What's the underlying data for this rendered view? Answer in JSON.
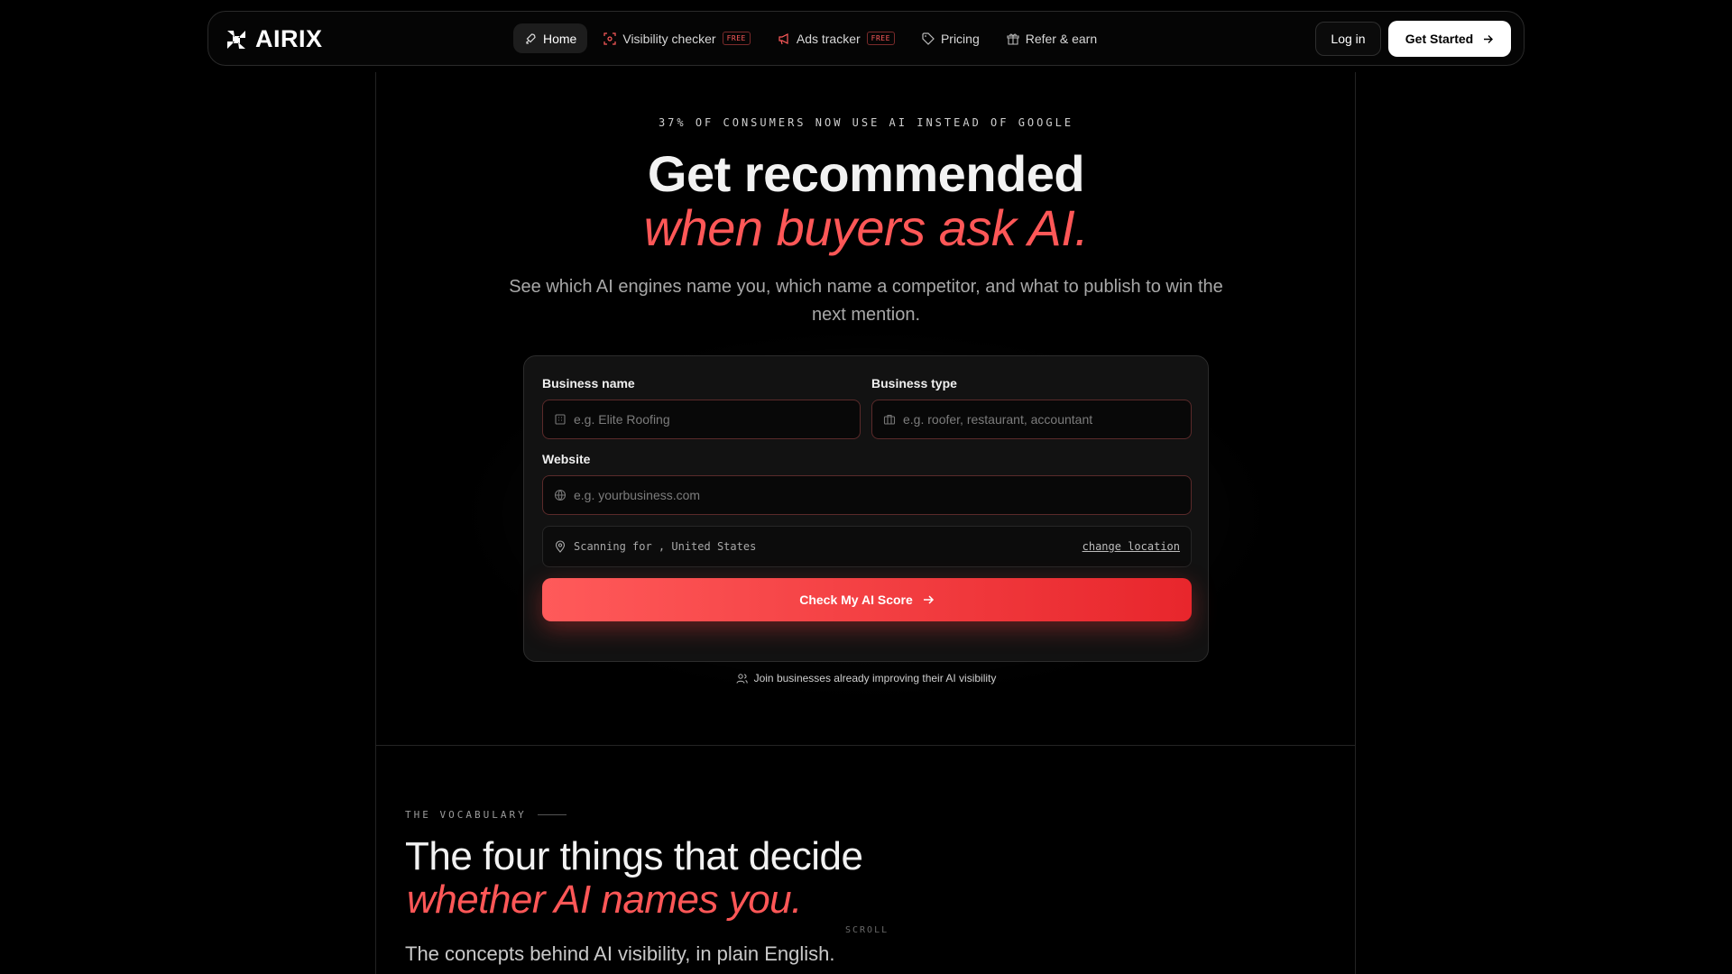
{
  "nav": {
    "logo": "AIRIX",
    "items": [
      {
        "label": "Home",
        "icon": "rocket-icon",
        "active": true
      },
      {
        "label": "Visibility checker",
        "icon": "scan-icon",
        "badge": "FREE"
      },
      {
        "label": "Ads tracker",
        "icon": "megaphone-icon",
        "badge": "FREE"
      },
      {
        "label": "Pricing",
        "icon": "tag-icon"
      },
      {
        "label": "Refer & earn",
        "icon": "gift-icon"
      }
    ],
    "login": "Log in",
    "get_started": "Get Started"
  },
  "hero": {
    "eyebrow": "37% OF CONSUMERS NOW USE AI INSTEAD OF GOOGLE",
    "title": "Get recommended",
    "title_accent": "when buyers ask AI.",
    "subtitle": "See which AI engines name you, which name a competitor, and what to publish to win the next mention."
  },
  "form": {
    "business_name_label": "Business name",
    "business_name_placeholder": "e.g. Elite Roofing",
    "business_type_label": "Business type",
    "business_type_placeholder": "e.g. roofer, restaurant, accountant",
    "website_label": "Website",
    "website_placeholder": "e.g. yourbusiness.com",
    "scan_text": "Scanning for , United States",
    "change_location": "change location",
    "cta": "Check My AI Score",
    "join_text": "Join businesses already improving their AI visibility"
  },
  "vocabulary": {
    "eyebrow": "THE VOCABULARY",
    "title": "The four things that decide",
    "title_accent": "whether AI names you.",
    "subtitle": "The concepts behind AI visibility, in plain English.",
    "scroll_hint": "SCROLL"
  },
  "colors": {
    "accent": "#ff5757",
    "background": "#000000",
    "card": "#121212"
  }
}
